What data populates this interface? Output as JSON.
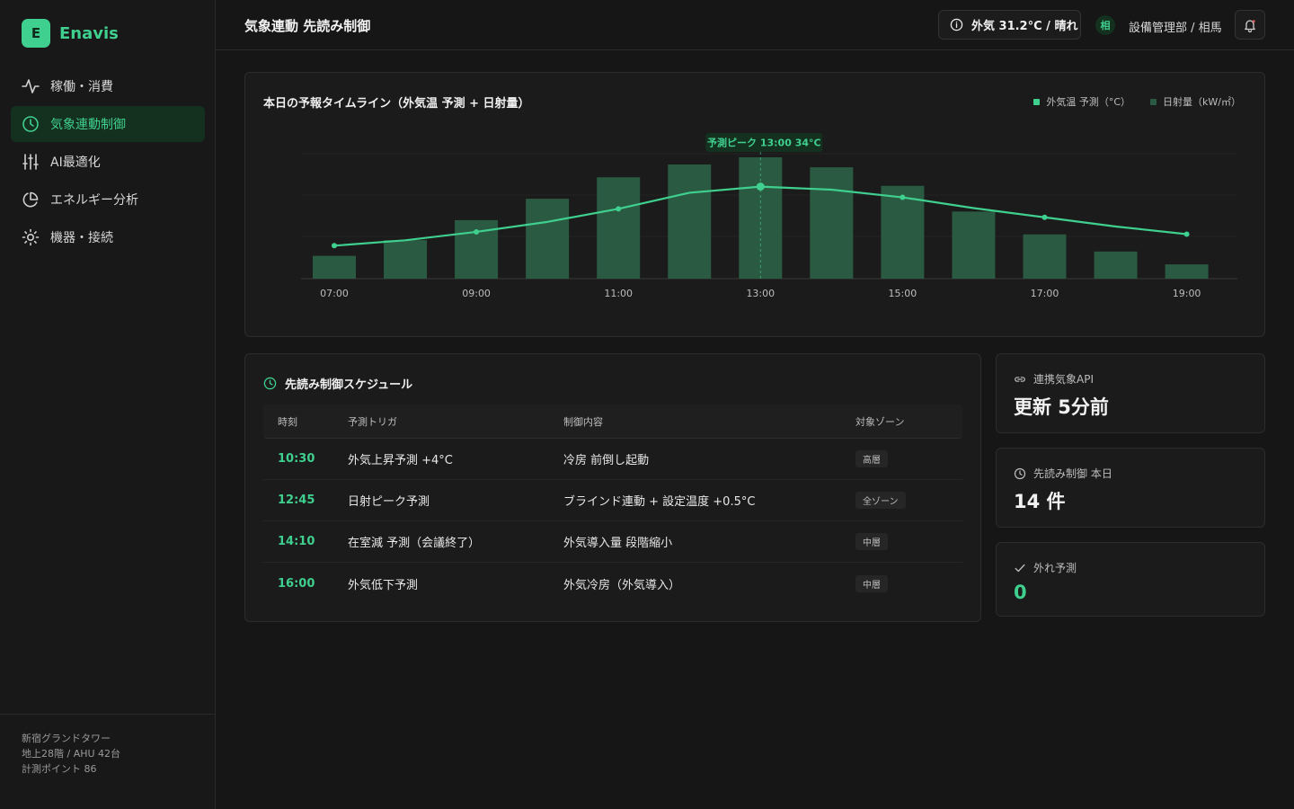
{
  "brand": {
    "logo_letter": "E",
    "name": "Enavis"
  },
  "nav": {
    "items": [
      {
        "label": "稼働・消費",
        "icon": "activity-icon"
      },
      {
        "label": "気象連動制御",
        "icon": "clock-icon",
        "active": true
      },
      {
        "label": "AI最適化",
        "icon": "sliders-icon"
      },
      {
        "label": "エネルギー分析",
        "icon": "pie-chart-icon"
      },
      {
        "label": "機器・接続",
        "icon": "sun-gear-icon"
      }
    ]
  },
  "site": {
    "line1": "新宿グランドタワー",
    "line2": "地上28階 / AHU 42台",
    "line3": "計測ポイント 86"
  },
  "header": {
    "title": "気象連動 先読み制御",
    "weather": "外気 31.2°C / 晴れ",
    "avatar": "相",
    "user": "設備管理部 / 相馬"
  },
  "colors": {
    "accent": "#3fcf8e",
    "bar": "#2a5a41",
    "background": "#161616",
    "card": "#1b1b1b"
  },
  "chart_card": {
    "title": "本日の予報タイムライン（外気温 予測 + 日射量）",
    "legend": [
      "外気温 予測（°C）",
      "日射量（kW/㎡）"
    ]
  },
  "chart_data": {
    "type": "bar",
    "x": [
      "07:00",
      "08:00",
      "09:00",
      "10:00",
      "11:00",
      "12:00",
      "13:00",
      "14:00",
      "15:00",
      "16:00",
      "17:00",
      "18:00",
      "19:00"
    ],
    "xticks": [
      "07:00",
      "09:00",
      "11:00",
      "13:00",
      "15:00",
      "17:00",
      "19:00"
    ],
    "series": [
      {
        "name": "日射量（kW/㎡）",
        "type": "bar",
        "values": [
          0.16,
          0.27,
          0.41,
          0.56,
          0.71,
          0.8,
          0.85,
          0.78,
          0.65,
          0.47,
          0.31,
          0.19,
          0.1
        ]
      },
      {
        "name": "外気温 予測（°C）",
        "type": "line",
        "values": [
          24.3,
          25.0,
          26.1,
          27.4,
          29.1,
          31.2,
          32.0,
          31.6,
          30.6,
          29.2,
          28.0,
          26.8,
          25.8
        ]
      }
    ],
    "annotation": {
      "x": "13:00",
      "label": "予測ピーク 13:00 34°C"
    },
    "ylim_bar": [
      0,
      0.85
    ],
    "ylim_line": [
      20,
      35
    ],
    "grid": true
  },
  "schedule": {
    "title": "先読み制御スケジュール",
    "headers": [
      "時刻",
      "予測トリガ",
      "制御内容",
      "対象ゾーン"
    ],
    "rows": [
      {
        "time": "10:30",
        "trigger": "外気上昇予測 +4°C",
        "action": "冷房 前倒し起動",
        "zone": "高層"
      },
      {
        "time": "12:45",
        "trigger": "日射ピーク予測",
        "action": "ブラインド連動 + 設定温度 +0.5°C",
        "zone": "全ゾーン"
      },
      {
        "time": "14:10",
        "trigger": "在室減 予測（会議終了）",
        "action": "外気導入量 段階縮小",
        "zone": "中層"
      },
      {
        "time": "16:00",
        "trigger": "外気低下予測",
        "action": "外気冷房（外気導入）",
        "zone": "中層"
      }
    ]
  },
  "stats": [
    {
      "label": "連携気象API",
      "value": "更新 5分前",
      "icon": "link-icon"
    },
    {
      "label": "先読み制御 本日",
      "value": "14 件",
      "icon": "clock-icon"
    },
    {
      "label": "外れ予測",
      "value": "0",
      "icon": "check-icon"
    }
  ]
}
